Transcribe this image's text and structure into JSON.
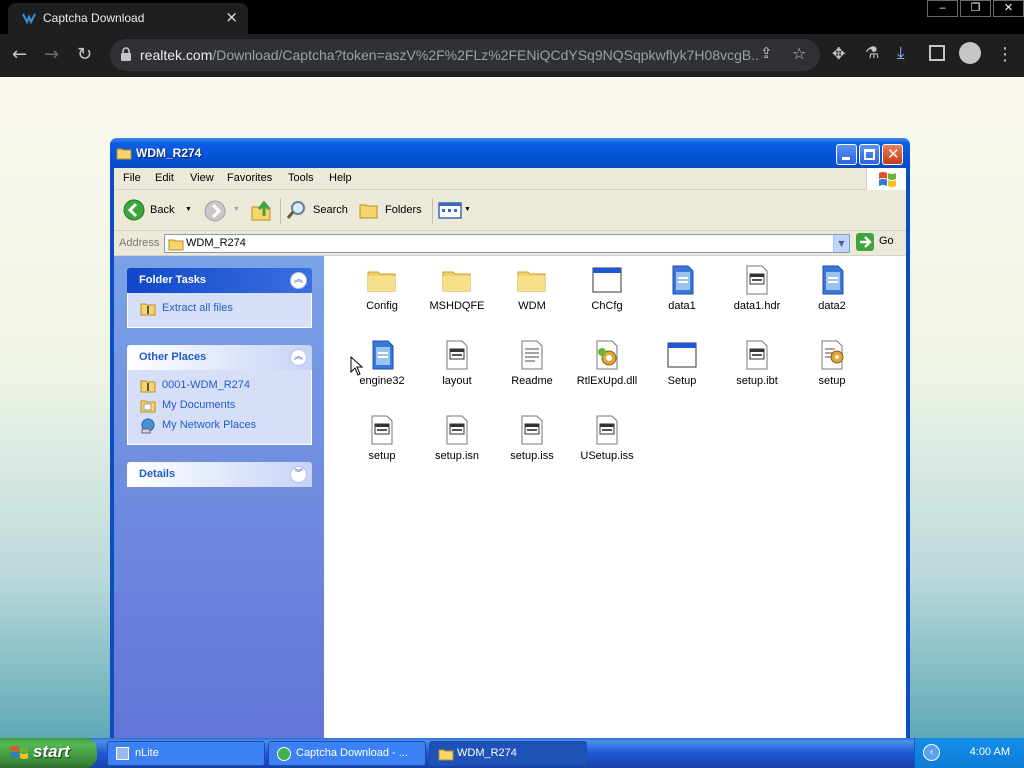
{
  "browser": {
    "tab_title": "Captcha Download",
    "url_host": "realtek.com",
    "url_path": "/Download/Captcha?token=aszV%2F%2FLz%2FENiQCdYSq9NQSqpkwflyk7H08vcgB...",
    "window_controls": [
      "‒",
      "❐",
      "✕"
    ]
  },
  "explorer": {
    "title": "WDM_R274",
    "menu": [
      "File",
      "Edit",
      "View",
      "Favorites",
      "Tools",
      "Help"
    ],
    "toolbar": {
      "back": "Back",
      "search": "Search",
      "folders": "Folders"
    },
    "address": {
      "label": "Address",
      "value": "WDM_R274",
      "go": "Go"
    },
    "tasks": {
      "folder_tasks": {
        "title": "Folder Tasks",
        "items": [
          "Extract all files"
        ]
      },
      "other_places": {
        "title": "Other Places",
        "items": [
          "0001-WDM_R274",
          "My Documents",
          "My Network Places"
        ]
      },
      "details": {
        "title": "Details"
      }
    },
    "files": [
      {
        "name": "Config",
        "icon": "folder-icon"
      },
      {
        "name": "MSHDQFE",
        "icon": "folder-icon"
      },
      {
        "name": "WDM",
        "icon": "folder-icon"
      },
      {
        "name": "ChCfg",
        "icon": "application-window-icon"
      },
      {
        "name": "data1",
        "icon": "cabinet-file-icon"
      },
      {
        "name": "data1.hdr",
        "icon": "generic-file-icon"
      },
      {
        "name": "data2",
        "icon": "cabinet-file-icon"
      },
      {
        "name": "engine32",
        "icon": "cabinet-file-icon"
      },
      {
        "name": "layout",
        "icon": "generic-file-icon"
      },
      {
        "name": "Readme",
        "icon": "text-document-icon"
      },
      {
        "name": "RtlExUpd.dll",
        "icon": "dll-gear-icon"
      },
      {
        "name": "Setup",
        "icon": "application-window-icon"
      },
      {
        "name": "setup.ibt",
        "icon": "generic-file-icon"
      },
      {
        "name": "setup",
        "icon": "setup-config-icon"
      },
      {
        "name": "setup",
        "icon": "generic-file-icon"
      },
      {
        "name": "setup.isn",
        "icon": "generic-file-icon"
      },
      {
        "name": "setup.iss",
        "icon": "generic-file-icon"
      },
      {
        "name": "USetup.iss",
        "icon": "generic-file-icon"
      }
    ]
  },
  "taskbar": {
    "start": "start",
    "tasks": [
      "nLite",
      "Captcha Download - ...",
      "WDM_R274"
    ],
    "clock": "4:00 AM"
  },
  "colors": {
    "xp_title_blue": "#0553d9",
    "task_pane_blue": "#6f8ddf",
    "link_blue": "#215dc6",
    "start_green": "#3c9a3c"
  }
}
